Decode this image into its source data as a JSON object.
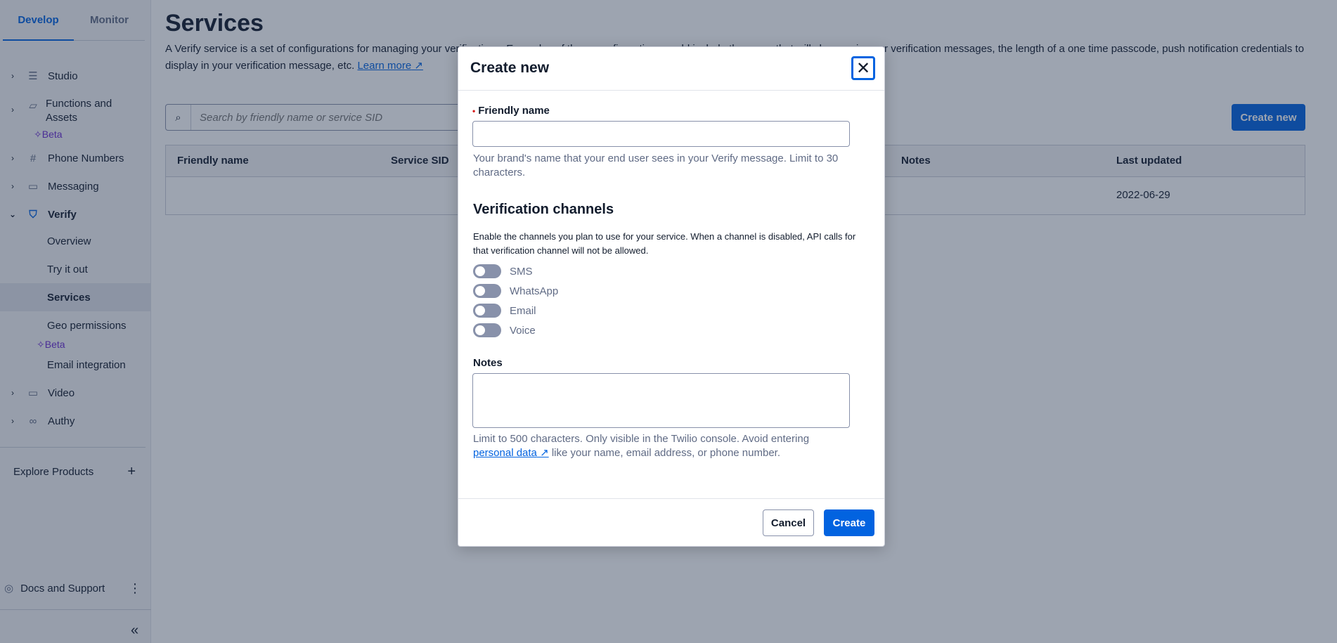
{
  "sidebar": {
    "tabs": [
      "Develop",
      "Monitor"
    ],
    "items": {
      "studio": "Studio",
      "functions": "Functions and Assets",
      "functions_badge": "Beta",
      "phone_numbers": "Phone Numbers",
      "messaging": "Messaging",
      "verify": "Verify",
      "verify_sub": [
        "Overview",
        "Try it out",
        "Services",
        "Geo permissions",
        "Email integration"
      ],
      "geo_badge": "Beta",
      "video": "Video",
      "authy": "Authy"
    },
    "explore": "Explore Products",
    "docs": "Docs and Support"
  },
  "main": {
    "title": "Services",
    "description": "A Verify service is a set of configurations for managing your verifications. Examples of these configurations could include the name that will show up in your verification messages, the length of a one time passcode, push notification credentials to display in your verification message, etc.",
    "learn_more": "Learn more",
    "search_placeholder": "Search by friendly name or service SID",
    "create_new": "Create new",
    "table": {
      "headers": [
        "Friendly name",
        "Service SID",
        "Notes",
        "Last updated"
      ],
      "rows": [
        {
          "friendly_name": "",
          "service_sid": "",
          "notes": "",
          "last_updated": "2022-06-29"
        }
      ]
    }
  },
  "modal": {
    "title": "Create new",
    "friendly_name_label": "Friendly name",
    "friendly_name_help": "Your brand's name that your end user sees in your Verify message. Limit to 30 characters.",
    "channels_title": "Verification channels",
    "channels_desc": "Enable the channels you plan to use for your service. When a channel is disabled, API calls for that verification channel will not be allowed.",
    "channels": [
      "SMS",
      "WhatsApp",
      "Email",
      "Voice"
    ],
    "notes_label": "Notes",
    "notes_help_1": "Limit to 500 characters. Only visible in the Twilio console. Avoid entering",
    "notes_help_link": "personal data",
    "notes_help_2": "like your name, email address, or phone number.",
    "cancel": "Cancel",
    "create": "Create"
  },
  "colors": {
    "accent": "#0263e0",
    "beta": "#6d2ed1",
    "overlay": "rgba(31,48,76,0.44)"
  }
}
